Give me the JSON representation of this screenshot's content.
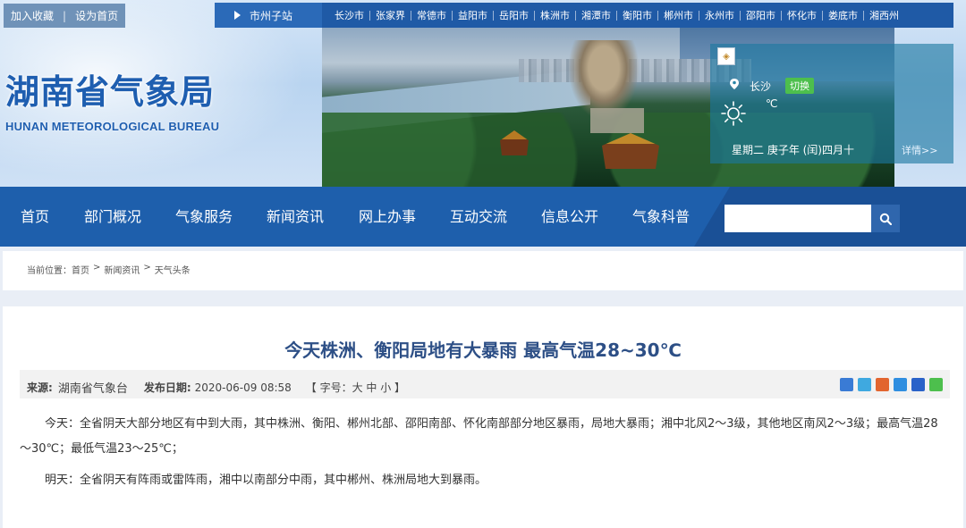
{
  "top_links": {
    "favorite": "加入收藏",
    "homepage": "设为首页"
  },
  "city_bar": {
    "label": "市州子站",
    "cities": [
      "长沙市",
      "张家界",
      "常德市",
      "益阳市",
      "岳阳市",
      "株洲市",
      "湘潭市",
      "衡阳市",
      "郴州市",
      "永州市",
      "邵阳市",
      "怀化市",
      "娄底市",
      "湘西州"
    ]
  },
  "logo": {
    "cn": "湖南省气象局",
    "en": "HUNAN METEOROLOGICAL BUREAU"
  },
  "weather": {
    "city": "长沙",
    "switch": "切换",
    "unit": "℃",
    "date": "星期二 庚子年 (闰)四月十",
    "detail": "详情>>",
    "icon": "sun-icon"
  },
  "nav": [
    "首页",
    "部门概况",
    "气象服务",
    "新闻资讯",
    "网上办事",
    "互动交流",
    "信息公开",
    "气象科普"
  ],
  "search": {
    "placeholder": "",
    "icon": "search-icon"
  },
  "breadcrumb": [
    "当前位置：首页",
    ">",
    "新闻资讯",
    ">",
    "天气头条"
  ],
  "article": {
    "title": "今天株洲、衡阳局地有大暴雨 最高气温28~30℃",
    "source_label": "来源:",
    "source": "湖南省气象台",
    "date_label": "发布日期:",
    "date": "2020-06-09 08:58",
    "font_size": "【 字号：大 中 小 】",
    "paragraphs": [
      "今天：全省阴天大部分地区有中到大雨，其中株洲、衡阳、郴州北部、邵阳南部、怀化南部部分地区暴雨，局地大暴雨；湘中北风2～3级，其他地区南风2～3级；最高气温28～30℃；最低气温23～25℃；",
      "明天：全省阴天有阵雨或雷阵雨，湘中以南部分中雨，其中郴州、株洲局地大到暴雨。"
    ],
    "share_colors": [
      "#3a7bd5",
      "#3fa9e0",
      "#e2652f",
      "#2f8ee0",
      "#2a62c9",
      "#4dbf4d"
    ]
  }
}
